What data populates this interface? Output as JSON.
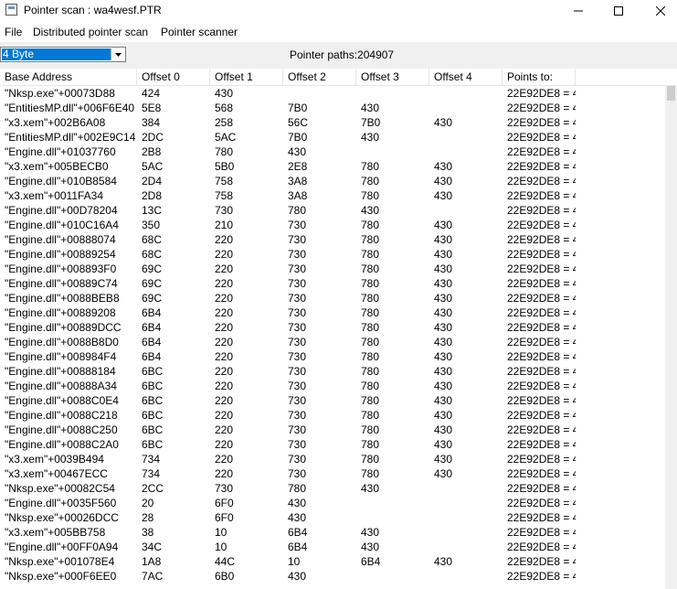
{
  "window": {
    "title": "Pointer scan : wa4wesf.PTR"
  },
  "menu": [
    "File",
    "Distributed pointer scan",
    "Pointer scanner"
  ],
  "toolbar": {
    "type_value": "4 Byte",
    "pointer_paths": "Pointer paths:204907"
  },
  "table": {
    "columns": [
      "Base Address",
      "Offset 0",
      "Offset 1",
      "Offset 2",
      "Offset 3",
      "Offset 4",
      "Points to:",
      ""
    ],
    "rows": [
      [
        "\"Nksp.exe\"+00073D88",
        "424",
        "430",
        "",
        "",
        "",
        "22E92DE8 = 4"
      ],
      [
        "\"EntitiesMP.dll\"+006F6E40",
        "5E8",
        "568",
        "7B0",
        "430",
        "",
        "22E92DE8 = 4"
      ],
      [
        "\"x3.xem\"+002B6A08",
        "384",
        "258",
        "56C",
        "7B0",
        "430",
        "22E92DE8 = 4"
      ],
      [
        "\"EntitiesMP.dll\"+002E9C14",
        "2DC",
        "5AC",
        "7B0",
        "430",
        "",
        "22E92DE8 = 4"
      ],
      [
        "\"Engine.dll\"+01037760",
        "2B8",
        "780",
        "430",
        "",
        "",
        "22E92DE8 = 4"
      ],
      [
        "\"x3.xem\"+005BECB0",
        "5AC",
        "5B0",
        "2E8",
        "780",
        "430",
        "22E92DE8 = 4"
      ],
      [
        "\"Engine.dll\"+010B8584",
        "2D4",
        "758",
        "3A8",
        "780",
        "430",
        "22E92DE8 = 4"
      ],
      [
        "\"x3.xem\"+0011FA34",
        "2D8",
        "758",
        "3A8",
        "780",
        "430",
        "22E92DE8 = 4"
      ],
      [
        "\"Engine.dll\"+00D78204",
        "13C",
        "730",
        "780",
        "430",
        "",
        "22E92DE8 = 4"
      ],
      [
        "\"Engine.dll\"+010C16A4",
        "350",
        "210",
        "730",
        "780",
        "430",
        "22E92DE8 = 4"
      ],
      [
        "\"Engine.dll\"+00888074",
        "68C",
        "220",
        "730",
        "780",
        "430",
        "22E92DE8 = 4"
      ],
      [
        "\"Engine.dll\"+00889254",
        "68C",
        "220",
        "730",
        "780",
        "430",
        "22E92DE8 = 4"
      ],
      [
        "\"Engine.dll\"+008893F0",
        "69C",
        "220",
        "730",
        "780",
        "430",
        "22E92DE8 = 4"
      ],
      [
        "\"Engine.dll\"+00889C74",
        "69C",
        "220",
        "730",
        "780",
        "430",
        "22E92DE8 = 4"
      ],
      [
        "\"Engine.dll\"+0088BEB8",
        "69C",
        "220",
        "730",
        "780",
        "430",
        "22E92DE8 = 4"
      ],
      [
        "\"Engine.dll\"+00889208",
        "6B4",
        "220",
        "730",
        "780",
        "430",
        "22E92DE8 = 4"
      ],
      [
        "\"Engine.dll\"+00889DCC",
        "6B4",
        "220",
        "730",
        "780",
        "430",
        "22E92DE8 = 4"
      ],
      [
        "\"Engine.dll\"+0088B8D0",
        "6B4",
        "220",
        "730",
        "780",
        "430",
        "22E92DE8 = 4"
      ],
      [
        "\"Engine.dll\"+008984F4",
        "6B4",
        "220",
        "730",
        "780",
        "430",
        "22E92DE8 = 4"
      ],
      [
        "\"Engine.dll\"+00888184",
        "6BC",
        "220",
        "730",
        "780",
        "430",
        "22E92DE8 = 4"
      ],
      [
        "\"Engine.dll\"+00888A34",
        "6BC",
        "220",
        "730",
        "780",
        "430",
        "22E92DE8 = 4"
      ],
      [
        "\"Engine.dll\"+0088C0E4",
        "6BC",
        "220",
        "730",
        "780",
        "430",
        "22E92DE8 = 4"
      ],
      [
        "\"Engine.dll\"+0088C218",
        "6BC",
        "220",
        "730",
        "780",
        "430",
        "22E92DE8 = 4"
      ],
      [
        "\"Engine.dll\"+0088C250",
        "6BC",
        "220",
        "730",
        "780",
        "430",
        "22E92DE8 = 4"
      ],
      [
        "\"Engine.dll\"+0088C2A0",
        "6BC",
        "220",
        "730",
        "780",
        "430",
        "22E92DE8 = 4"
      ],
      [
        "\"x3.xem\"+0039B494",
        "734",
        "220",
        "730",
        "780",
        "430",
        "22E92DE8 = 4"
      ],
      [
        "\"x3.xem\"+00467ECC",
        "734",
        "220",
        "730",
        "780",
        "430",
        "22E92DE8 = 4"
      ],
      [
        "\"Nksp.exe\"+00082C54",
        "2CC",
        "730",
        "780",
        "430",
        "",
        "22E92DE8 = 4"
      ],
      [
        "\"Engine.dll\"+0035F560",
        "20",
        "6F0",
        "430",
        "",
        "",
        "22E92DE8 = 4"
      ],
      [
        "\"Nksp.exe\"+00026DCC",
        "28",
        "6F0",
        "430",
        "",
        "",
        "22E92DE8 = 4"
      ],
      [
        "\"x3.xem\"+005BB758",
        "38",
        "10",
        "6B4",
        "430",
        "",
        "22E92DE8 = 4"
      ],
      [
        "\"Engine.dll\"+00FF0A94",
        "34C",
        "10",
        "6B4",
        "430",
        "",
        "22E92DE8 = 4"
      ],
      [
        "\"Nksp.exe\"+001078E4",
        "1A8",
        "44C",
        "10",
        "6B4",
        "430",
        "22E92DE8 = 4"
      ],
      [
        "\"Nksp.exe\"+000F6EE0",
        "7AC",
        "6B0",
        "430",
        "",
        "",
        "22E92DE8 = 4"
      ]
    ]
  }
}
